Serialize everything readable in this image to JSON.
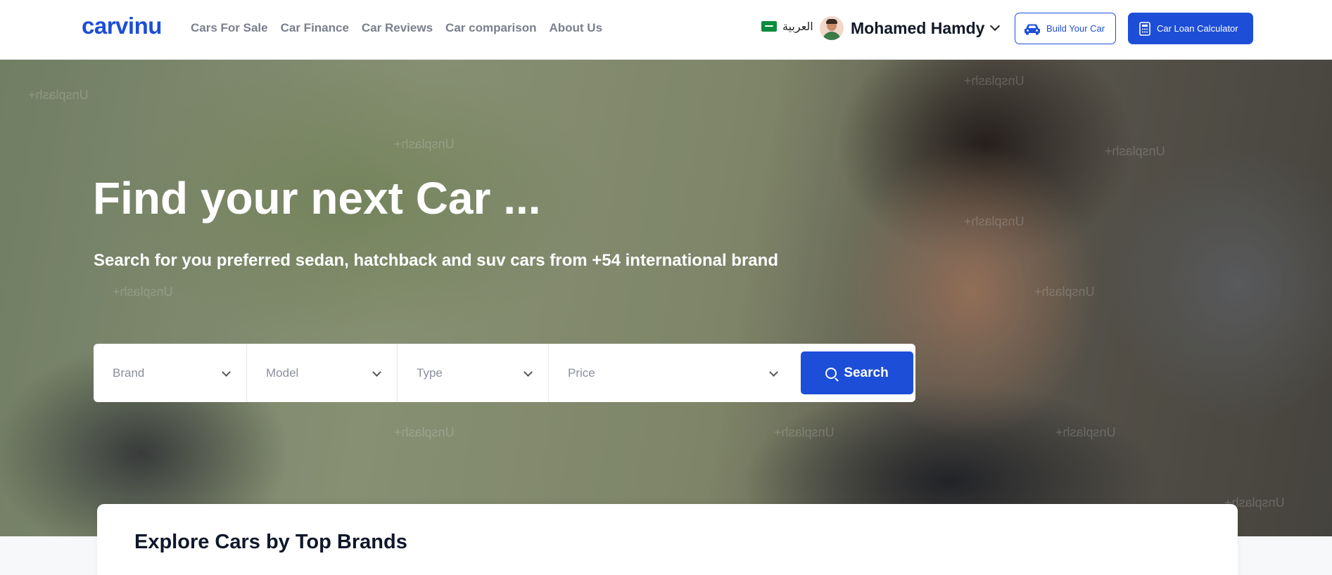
{
  "header": {
    "logo": "carvinu",
    "nav": [
      "Cars For Sale",
      "Car Finance",
      "Car Reviews",
      "Car comparison",
      "About Us"
    ],
    "language_label": "العربية",
    "language_flag_icon": "saudi-flag-icon",
    "user_name": "Mohamed Hamdy",
    "build_car_label": "Build Your Car",
    "loan_calc_label": "Car Loan Calculator"
  },
  "hero": {
    "title": "Find your next Car ...",
    "subtitle": "Search for you preferred sedan, hatchback and suv cars from +54 international brand",
    "watermark": "Unsplash+"
  },
  "search": {
    "brand_placeholder": "Brand",
    "model_placeholder": "Model",
    "type_placeholder": "Type",
    "price_placeholder": "Price",
    "button_label": "Search"
  },
  "section": {
    "title": "Explore Cars by Top Brands"
  },
  "colors": {
    "brand_blue": "#1d4ed8"
  }
}
